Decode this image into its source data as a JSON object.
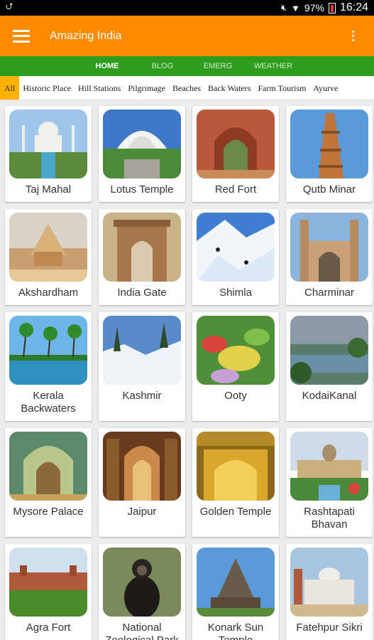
{
  "status": {
    "battery": "97%",
    "time": "16:24",
    "usb_icon": "usb-icon",
    "mute_icon": "mute-icon",
    "wifi_icon": "wifi-icon"
  },
  "appbar": {
    "title": "Amazing India",
    "menu_icon": "hamburger-icon",
    "overflow_icon": "more-vert-icon"
  },
  "tabs": [
    {
      "label": "HOME",
      "active": true
    },
    {
      "label": "BLOG"
    },
    {
      "label": "EMERG"
    },
    {
      "label": "WEATHER"
    }
  ],
  "categories": [
    "All",
    "Historic Place",
    "Hill Stations",
    "Pilgrimage",
    "Beaches",
    "Back Waters",
    "Farm Tourism",
    "Ayurve"
  ],
  "places": [
    {
      "label": "Taj Mahal"
    },
    {
      "label": "Lotus Temple"
    },
    {
      "label": "Red Fort"
    },
    {
      "label": "Qutb Minar"
    },
    {
      "label": "Akshardham"
    },
    {
      "label": "India Gate"
    },
    {
      "label": "Shimla"
    },
    {
      "label": "Charminar"
    },
    {
      "label": "Kerala Backwaters"
    },
    {
      "label": "Kashmir"
    },
    {
      "label": "Ooty"
    },
    {
      "label": "KodaiKanal"
    },
    {
      "label": "Mysore Palace"
    },
    {
      "label": "Jaipur"
    },
    {
      "label": "Golden Temple"
    },
    {
      "label": "Rashtapati Bhavan"
    },
    {
      "label": "Agra Fort"
    },
    {
      "label": "National Zoological Park"
    },
    {
      "label": "Konark Sun Temple"
    },
    {
      "label": "Fatehpur Sikri"
    }
  ],
  "colors": {
    "appbar": "#ff8a00",
    "tabs": "#2e9e1f",
    "chip_active": "#ffb300"
  }
}
